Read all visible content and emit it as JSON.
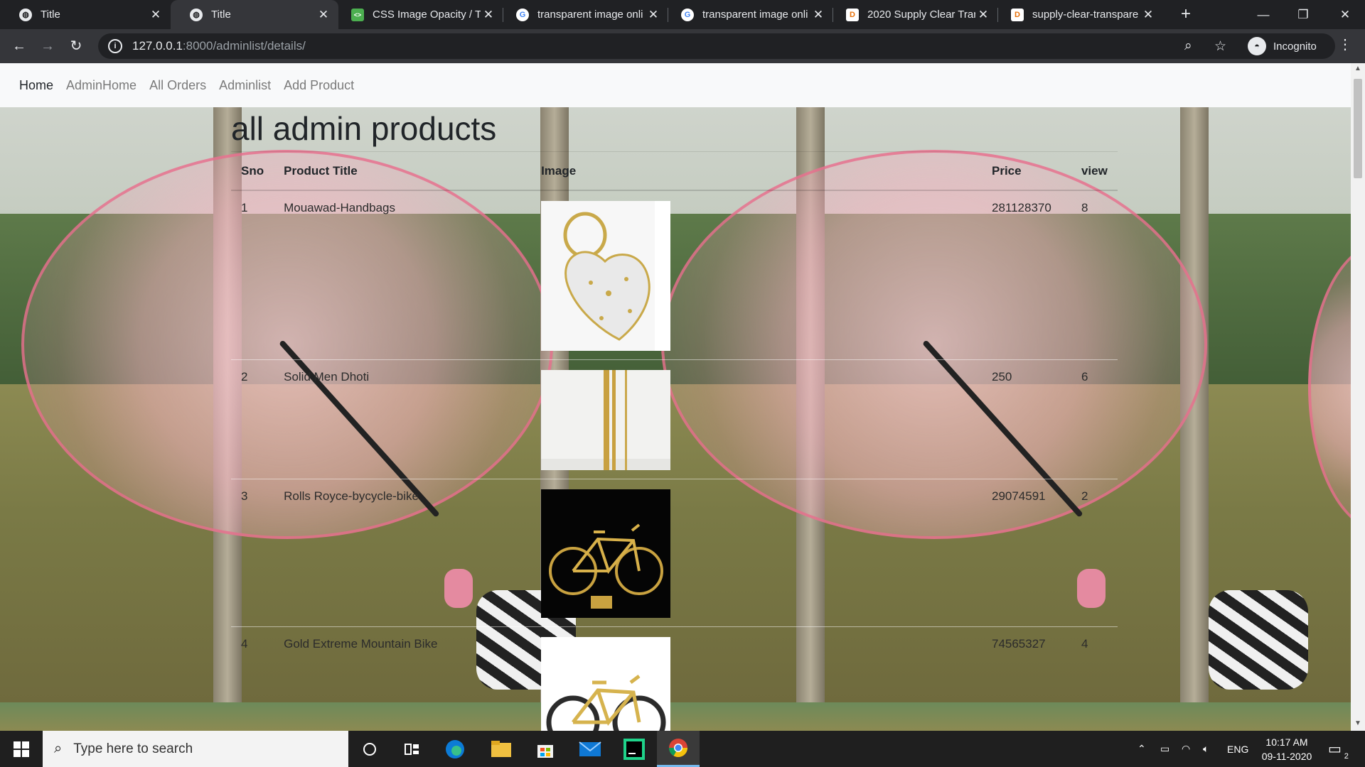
{
  "browser": {
    "tabs": [
      {
        "label": "Title",
        "favicon": "globe-icon"
      },
      {
        "label": "Title",
        "favicon": "globe-icon",
        "active": true
      },
      {
        "label": "CSS Image Opacity / Tr",
        "favicon": "css-site-icon"
      },
      {
        "label": "transparent image onli",
        "favicon": "google-icon"
      },
      {
        "label": "transparent image onli",
        "favicon": "google-icon"
      },
      {
        "label": "2020 Supply Clear Tran",
        "favicon": "d-site-icon"
      },
      {
        "label": "supply-clear-transpare",
        "favicon": "d-site-icon"
      }
    ],
    "url_host": "127.0.0.1",
    "url_path": ":8000/adminlist/details/",
    "profile_label": "Incognito"
  },
  "nav": {
    "brand": "Home",
    "links": [
      "AdminHome",
      "All Orders",
      "Adminlist",
      "Add Product"
    ]
  },
  "page": {
    "title": "all admin products",
    "headers": [
      "Sno",
      "Product Title",
      "Image",
      "Price",
      "view"
    ],
    "rows": [
      {
        "sno": "1",
        "title": "Mouawad-Handbags",
        "image": "heart-handbag-image",
        "price": "281128370",
        "view": "8"
      },
      {
        "sno": "2",
        "title": "Solid Men Dhoti",
        "image": "white-dhoti-image",
        "price": "250",
        "view": "6"
      },
      {
        "sno": "3",
        "title": "Rolls Royce-bycycle-bike",
        "image": "gold-bicycle-image",
        "price": "29074591",
        "view": "2"
      },
      {
        "sno": "4",
        "title": "Gold Extreme Mountain Bike",
        "image": "gold-mountain-bike-image",
        "price": "74565327",
        "view": "4"
      }
    ]
  },
  "taskbar": {
    "search_placeholder": "Type here to search",
    "language": "ENG",
    "time": "10:17 AM",
    "date": "09-11-2020",
    "notification_count": "2"
  }
}
